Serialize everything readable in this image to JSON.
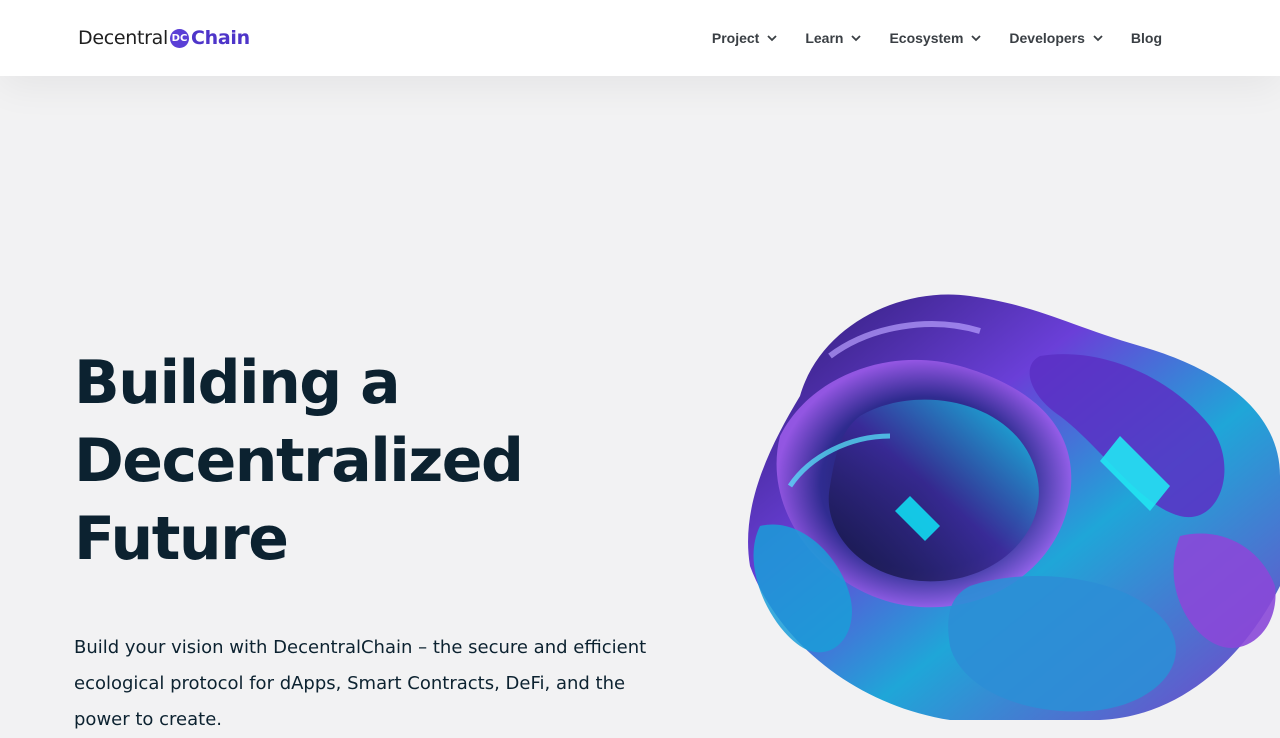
{
  "header": {
    "logo": {
      "text_primary": "Decentral",
      "text_secondary": "Chain"
    },
    "nav": [
      {
        "label": "Project",
        "has_dropdown": true
      },
      {
        "label": "Learn",
        "has_dropdown": true
      },
      {
        "label": "Ecosystem",
        "has_dropdown": true
      },
      {
        "label": "Developers",
        "has_dropdown": true
      },
      {
        "label": "Blog",
        "has_dropdown": false
      }
    ]
  },
  "hero": {
    "title_lines": [
      "Building a",
      "Decentralized",
      "Future"
    ],
    "subtitle": "Build your vision with DecentralChain – the secure and efficient ecological protocol for dApps, Smart Contracts, DeFi, and the power to create."
  },
  "colors": {
    "brand": "#4e35c9",
    "heading": "#0c2230",
    "background": "#f2f2f3",
    "nav_text": "#3a3f44"
  }
}
